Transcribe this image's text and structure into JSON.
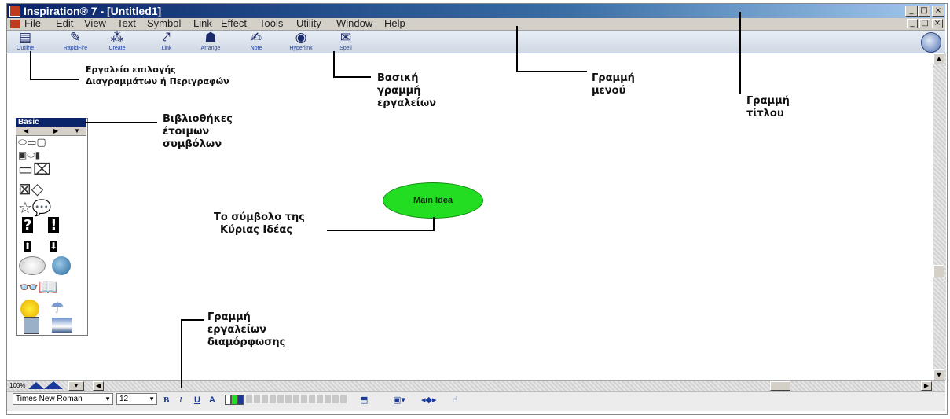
{
  "window": {
    "title": "Inspiration® 7 - [Untitled1]",
    "min_label": "_",
    "max_label": "□",
    "close_label": "×"
  },
  "menu": [
    "File",
    "Edit",
    "View",
    "Text",
    "Symbol",
    "Link",
    "Effect",
    "Tools",
    "Utility",
    "Window",
    "Help"
  ],
  "toolbar": {
    "tools": [
      {
        "label": "Outline",
        "icon": "outline-icon"
      },
      {
        "label": "RapidFire",
        "icon": "rapidfire-icon"
      },
      {
        "label": "Create",
        "icon": "create-icon"
      },
      {
        "label": "Link",
        "icon": "link-icon"
      },
      {
        "label": "Arrange",
        "icon": "arrange-icon"
      },
      {
        "label": "Note",
        "icon": "note-icon"
      },
      {
        "label": "Hyperlink",
        "icon": "hyperlink-icon"
      },
      {
        "label": "Spell",
        "icon": "spell-icon"
      }
    ]
  },
  "palette": {
    "title": "Basic"
  },
  "canvas": {
    "main_idea": "Main Idea"
  },
  "callouts": {
    "tool_selector": [
      "Εργαλείο επιλογής",
      "Διαγραμμάτων ή Περιγραφών"
    ],
    "basic_toolbar": [
      "Βασική",
      "γραμμή",
      "εργαλείων"
    ],
    "menu_bar": [
      "Γραμμή",
      "μενού"
    ],
    "title_bar": [
      "Γραμμή",
      "τίτλου"
    ],
    "symbol_libraries": [
      "Βιβλιοθήκες",
      "έτοιμων",
      "συμβόλων"
    ],
    "main_idea_symbol": [
      "Το σύμβολο της",
      "Κύριας Ιδέας"
    ],
    "format_toolbar": [
      "Γραμμή",
      "εργαλείων",
      "διαμόρφωσης"
    ]
  },
  "statusbar": {
    "zoom": "100%"
  },
  "format": {
    "font": "Times New Roman",
    "size": "12",
    "bold": "B",
    "italic": "I",
    "underline": "U",
    "color": "A"
  },
  "colors": {
    "title_bar": "#0a246a",
    "main_idea_fill": "#22dd22",
    "palette_title": "#0a246a"
  }
}
